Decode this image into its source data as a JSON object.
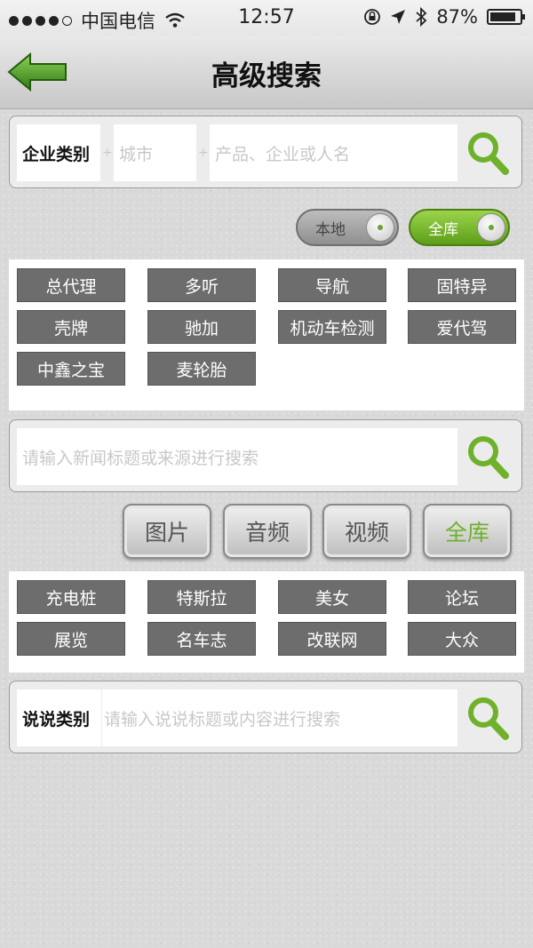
{
  "status_bar": {
    "carrier": "中国电信",
    "time": "12:57",
    "battery": "87%",
    "battery_level": 0.87,
    "icons": [
      "signal-dots-icon",
      "wifi-icon",
      "rotation-lock-icon",
      "location-arrow-icon",
      "bluetooth-icon",
      "battery-icon"
    ]
  },
  "nav": {
    "title": "高级搜索",
    "back_icon": "back-arrow-icon"
  },
  "company_search": {
    "category_label": "企业类别",
    "city_placeholder": "城市",
    "keyword_placeholder": "产品、企业或人名",
    "search_icon": "search-icon"
  },
  "scope_toggle": {
    "local_label": "本地",
    "all_label": "全库",
    "selected": "全库"
  },
  "company_tags": [
    "总代理",
    "多听",
    "导航",
    "固特异",
    "壳牌",
    "驰加",
    "机动车检测",
    "爱代驾",
    "中鑫之宝",
    "麦轮胎"
  ],
  "news_search": {
    "placeholder": "请输入新闻标题或来源进行搜索",
    "search_icon": "search-icon"
  },
  "media_tabs": {
    "items": [
      "图片",
      "音频",
      "视频",
      "全库"
    ],
    "selected": "全库"
  },
  "news_tags": [
    "充电桩",
    "特斯拉",
    "美女",
    "论坛",
    "展览",
    "名车志",
    "改联网",
    "大众"
  ],
  "talk_search": {
    "category_label": "说说类别",
    "placeholder": "请输入说说标题或内容进行搜索",
    "search_icon": "search-icon"
  },
  "colors": {
    "accent_green": "#6fb12a",
    "tag_gray": "#6d6d6d"
  }
}
